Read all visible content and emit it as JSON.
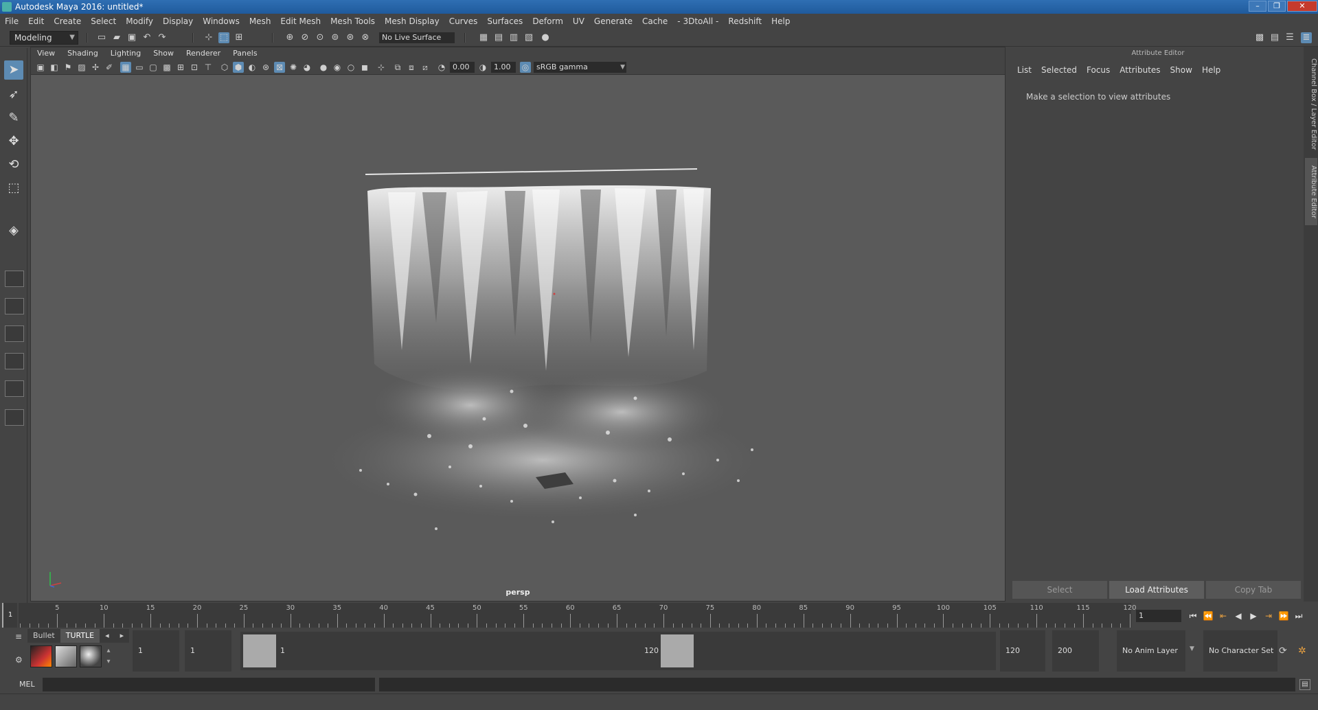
{
  "window": {
    "title": "Autodesk Maya 2016: untitled*",
    "controls": [
      "–",
      "❐",
      "✕"
    ]
  },
  "menu": [
    "File",
    "Edit",
    "Create",
    "Select",
    "Modify",
    "Display",
    "Windows",
    "Mesh",
    "Edit Mesh",
    "Mesh Tools",
    "Mesh Display",
    "Curves",
    "Surfaces",
    "Deform",
    "UV",
    "Generate",
    "Cache",
    "- 3DtoAll -",
    "Redshift",
    "Help"
  ],
  "statusline": {
    "mode": "Modeling",
    "live_surface": "No Live Surface"
  },
  "panel": {
    "menu": [
      "View",
      "Shading",
      "Lighting",
      "Show",
      "Renderer",
      "Panels"
    ],
    "exposure": "0.00",
    "gamma": "1.00",
    "color_space": "sRGB gamma",
    "camera": "persp"
  },
  "attribute_editor": {
    "title": "Attribute Editor",
    "menu": [
      "List",
      "Selected",
      "Focus",
      "Attributes",
      "Show",
      "Help"
    ],
    "message": "Make a selection to view attributes",
    "buttons": [
      "Select",
      "Load Attributes",
      "Copy Tab"
    ],
    "side_tabs": [
      "Channel Box / Layer Editor",
      "Attribute Editor"
    ]
  },
  "timeline": {
    "current_frame": "1",
    "start": 1,
    "end": 120,
    "ticks": [
      5,
      10,
      15,
      20,
      25,
      30,
      35,
      40,
      45,
      50,
      55,
      60,
      65,
      70,
      75,
      80,
      85,
      90,
      95,
      100,
      105,
      110,
      115,
      120
    ],
    "frame_field": "1"
  },
  "range": {
    "shelf_tabs": [
      "Bullet",
      "TURTLE"
    ],
    "start_field": "1",
    "playback_start": "1",
    "range_start_label": "1",
    "range_end_label": "120",
    "playback_end": "120",
    "end_field": "200",
    "anim_layer": "No Anim Layer",
    "character_set": "No Character Set"
  },
  "command": {
    "label": "MEL"
  },
  "colors": {
    "accent": "#5d8bb3",
    "viewport": "#5a5a5a",
    "panel": "#444444"
  }
}
